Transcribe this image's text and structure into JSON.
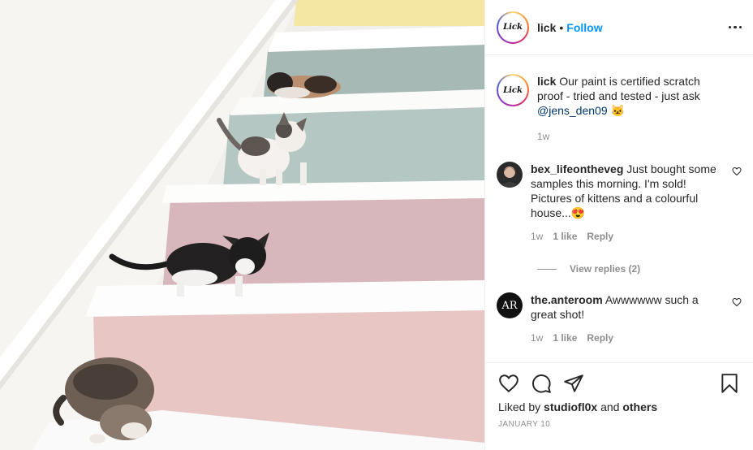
{
  "post": {
    "username": "lick",
    "separator": "•",
    "follow_label": "Follow",
    "logo_text": "Lick",
    "caption": {
      "username": "lick",
      "text": "Our paint is certified scratch proof - tried and tested - just ask",
      "mention": "@jens_den09",
      "emoji": "🐱",
      "time": "1w"
    },
    "comments": [
      {
        "username": "bex_lifeontheveg",
        "text": "Just bought some samples this morning. I'm sold! Pictures of kittens and a colourful house...",
        "emoji": "😍",
        "time": "1w",
        "likes": "1 like",
        "reply_label": "Reply",
        "view_replies": "View replies (2)"
      },
      {
        "username": "the.anteroom",
        "text": "Awwwwww such a great shot!",
        "avatar_text": "AR",
        "time": "1w",
        "likes": "1 like",
        "reply_label": "Reply"
      }
    ],
    "liked_by_prefix": "Liked by",
    "liked_by_user": "studiofl0x",
    "liked_by_and": "and",
    "liked_by_others": "others",
    "date": "JANUARY 10"
  },
  "icons": {
    "more": "more-options-icon",
    "like": "heart-icon",
    "comment": "comment-icon",
    "share": "paper-plane-icon",
    "save": "bookmark-icon"
  },
  "colors": {
    "link_blue": "#0095f6",
    "mention": "#00376b",
    "muted": "#8e8e8e",
    "text": "#262626"
  }
}
